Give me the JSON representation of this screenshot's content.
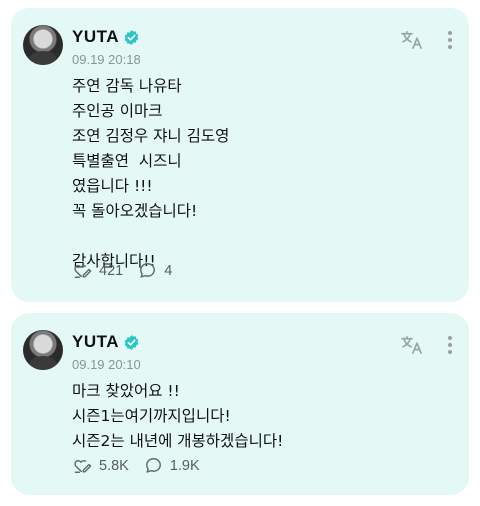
{
  "posts": [
    {
      "author": "YUTA",
      "time": "09.19 20:18",
      "lines": [
        "주연 감독 나유타",
        "주인공 이마크",
        "조연 김정우 쟈니 김도영",
        "특별출연  시즈니",
        "였읍니다 !!!",
        "꼭 돌아오겠습니다!",
        "",
        "감사합니다!!"
      ],
      "likes": "421",
      "comments": "4"
    },
    {
      "author": "YUTA",
      "time": "09.19 20:10",
      "lines": [
        "마크 찾았어요 !!",
        "시즌1는여기까지입니다!",
        "시즌2는 내년에 개봉하겠습니다!"
      ],
      "likes": "5.8K",
      "comments": "1.9K"
    }
  ],
  "icons": {
    "verified": "verified-badge-icon",
    "translate": "translate-icon",
    "more": "more-vertical-icon",
    "like": "heart-pen-icon",
    "comment": "comment-bubble-icon"
  },
  "colors": {
    "card_background": "#e4f9f6",
    "verified_badge": "#2ec4c6",
    "meta_text": "#8a9491"
  }
}
